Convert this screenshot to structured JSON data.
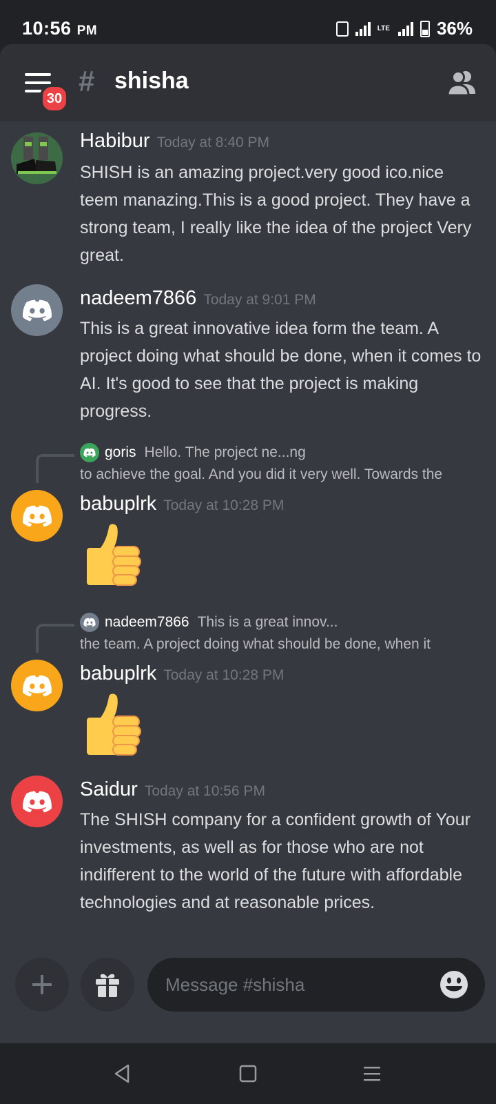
{
  "status": {
    "time": "10:56",
    "ampm": "PM",
    "network": "LTE",
    "battery": "36%"
  },
  "header": {
    "unread_count": "30",
    "hash": "#",
    "channel": "shisha"
  },
  "colors": {
    "background": "#36393f",
    "header": "#2f3136",
    "badge": "#ed4245",
    "avatar_grey": "#747f8d",
    "avatar_orange": "#faa61a",
    "avatar_red": "#ed4245",
    "avatar_green": "#3ba55c"
  },
  "messages": [
    {
      "author": "Habibur",
      "time": "Today at 8:40 PM",
      "text": "SHISH is an amazing project.very good ico.nice teem manazing.This is a good project. They have a strong team, I really like the idea of the project Very great.",
      "avatar_icon": "sneakers-photo"
    },
    {
      "author": "nadeem7866",
      "time": "Today at 9:01 PM",
      "text": "This is a great innovative idea form the team. A project doing what should be done, when it comes to AI. It's good to see that the project is making progress.",
      "avatar_icon": "discord-logo-icon"
    },
    {
      "reply_author": "goris",
      "reply_snippet": "Hello. The project ne...ng",
      "reply_continuation": "to achieve the goal. And you did it very well. Towards the",
      "author": "babuplrk",
      "time": "Today at 10:28 PM",
      "emoji": "thumbs-up-icon"
    },
    {
      "reply_author": "nadeem7866",
      "reply_snippet": "This is a great innov...",
      "reply_continuation": "the team. A project doing what should be done, when it",
      "author": "babuplrk",
      "time": "Today at 10:28 PM",
      "emoji": "thumbs-up-icon"
    },
    {
      "author": "Saidur",
      "time": "Today at 10:56 PM",
      "text": "The SHISH company for a confident growth of Your investments, as well as for those who are not indifferent to the world of the future with affordable technologies and at reasonable prices.",
      "avatar_icon": "discord-logo-icon"
    }
  ],
  "composer": {
    "placeholder": "Message #shisha"
  },
  "icons": [
    "menu-icon",
    "members-icon",
    "plus-icon",
    "gift-icon",
    "emoji-smile-icon",
    "back-icon",
    "home-icon",
    "recents-icon"
  ]
}
